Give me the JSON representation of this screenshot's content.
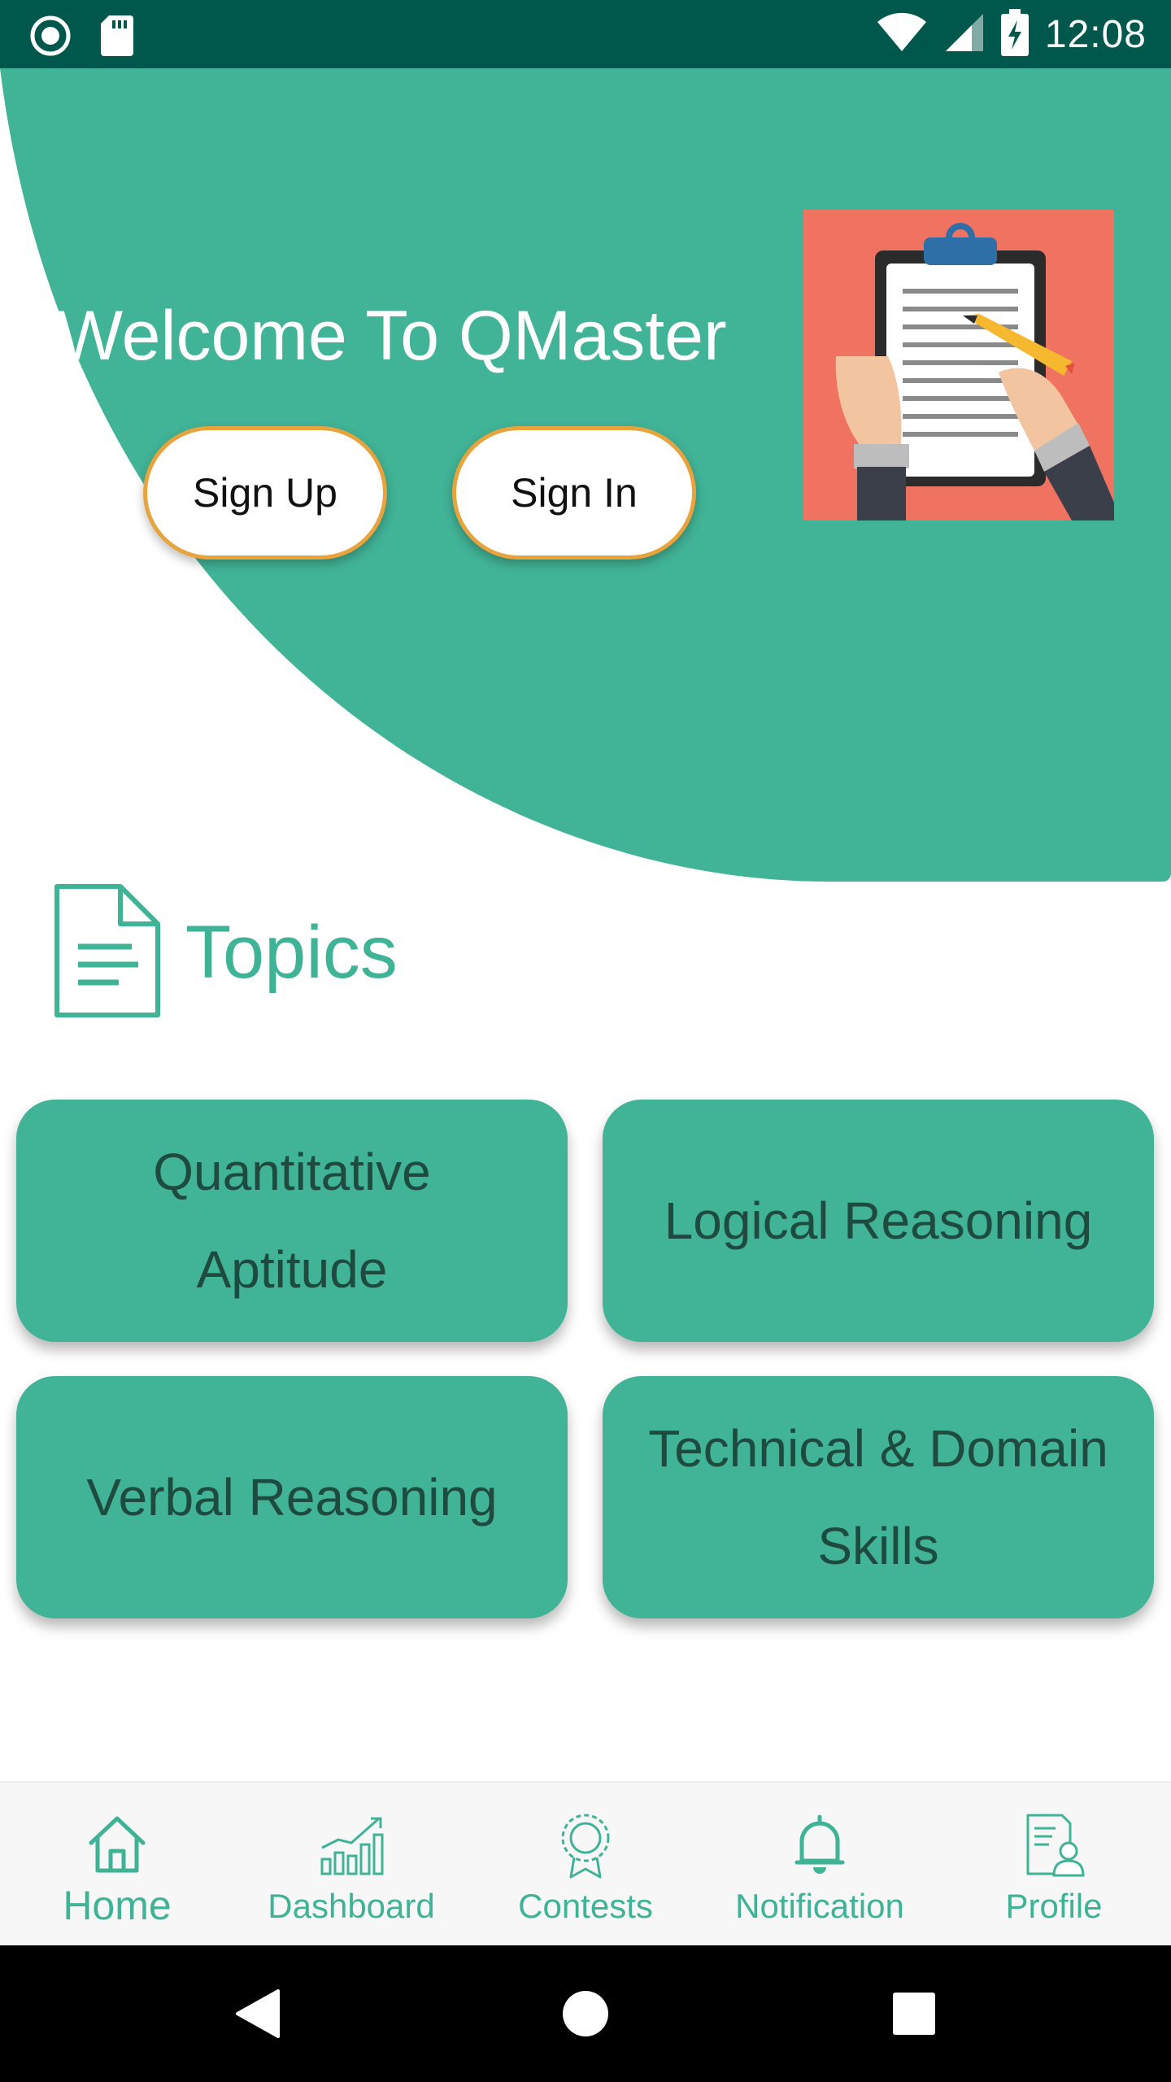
{
  "status_bar": {
    "time": "12:08",
    "icons": [
      "record-icon",
      "sd-card-icon",
      "wifi-icon",
      "cell-signal-icon",
      "battery-charging-icon"
    ]
  },
  "hero": {
    "title": "Welcome To QMaster",
    "signup_label": "Sign Up",
    "signin_label": "Sign In",
    "illustration": "clipboard-illustration"
  },
  "topics": {
    "heading": "Topics",
    "icon": "document-icon",
    "cards": [
      {
        "label": "Quantitative Aptitude"
      },
      {
        "label": "Logical Reasoning"
      },
      {
        "label": "Verbal Reasoning"
      },
      {
        "label": "Technical & Domain Skills"
      }
    ]
  },
  "bottom_nav": {
    "items": [
      {
        "label": "Home",
        "icon": "home-icon",
        "active": true
      },
      {
        "label": "Dashboard",
        "icon": "bar-chart-icon",
        "active": false
      },
      {
        "label": "Contests",
        "icon": "badge-icon",
        "active": false
      },
      {
        "label": "Notification",
        "icon": "bell-icon",
        "active": false
      },
      {
        "label": "Profile",
        "icon": "profile-icon",
        "active": false
      }
    ]
  },
  "colors": {
    "primary": "#41b396",
    "status_bar": "#00574b",
    "button_border": "#e8a33d",
    "illustration_bg": "#f07361"
  }
}
